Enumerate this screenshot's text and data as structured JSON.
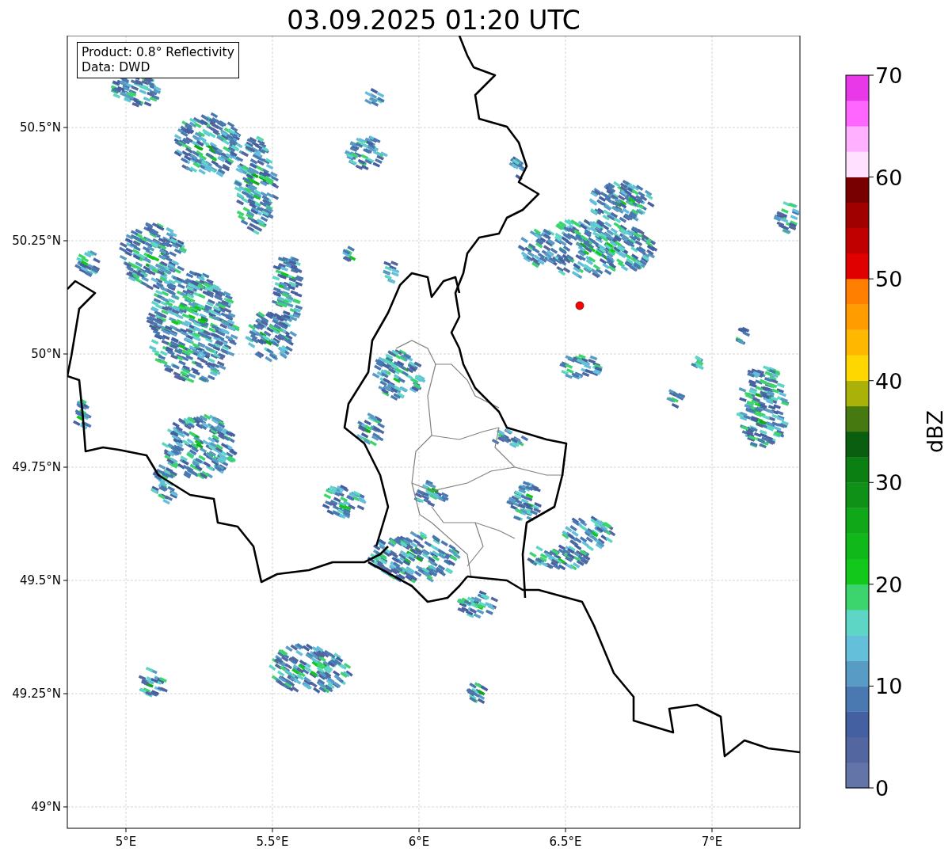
{
  "title": "03.09.2025 01:20 UTC",
  "info_box": {
    "lines": [
      "Product: 0.8° Reflectivity",
      "Data: DWD"
    ]
  },
  "map": {
    "x_ticks": [
      "5°E",
      "5.5°E",
      "6°E",
      "6.5°E",
      "7°E"
    ],
    "y_ticks": [
      "50.5°N",
      "50.25°N",
      "50°N",
      "49.75°N",
      "49.5°N",
      "49.25°N",
      "49°N"
    ]
  },
  "colorbar": {
    "label": "dBZ",
    "ticks": [
      "70",
      "60",
      "50",
      "40",
      "30",
      "20",
      "10",
      "0"
    ],
    "segments": [
      {
        "color": "#6374a8"
      },
      {
        "color": "#53669f"
      },
      {
        "color": "#4560a0"
      },
      {
        "color": "#4a78b0"
      },
      {
        "color": "#589bc4"
      },
      {
        "color": "#64bfdb"
      },
      {
        "color": "#5ed6c6"
      },
      {
        "color": "#3cd46c"
      },
      {
        "color": "#12c81a"
      },
      {
        "color": "#11b81a"
      },
      {
        "color": "#10a818"
      },
      {
        "color": "#0e9116"
      },
      {
        "color": "#0c7f13"
      },
      {
        "color": "#0a5e10"
      },
      {
        "color": "#467a10"
      },
      {
        "color": "#aab20a"
      },
      {
        "color": "#ffd700"
      },
      {
        "color": "#ffb700"
      },
      {
        "color": "#ff9c00"
      },
      {
        "color": "#ff8000"
      },
      {
        "color": "#e00000"
      },
      {
        "color": "#c00000"
      },
      {
        "color": "#a00000"
      },
      {
        "color": "#780000"
      },
      {
        "color": "#ffe0ff"
      },
      {
        "color": "#ffb0ff"
      },
      {
        "color": "#ff66ff"
      },
      {
        "color": "#e838e8"
      }
    ]
  }
}
